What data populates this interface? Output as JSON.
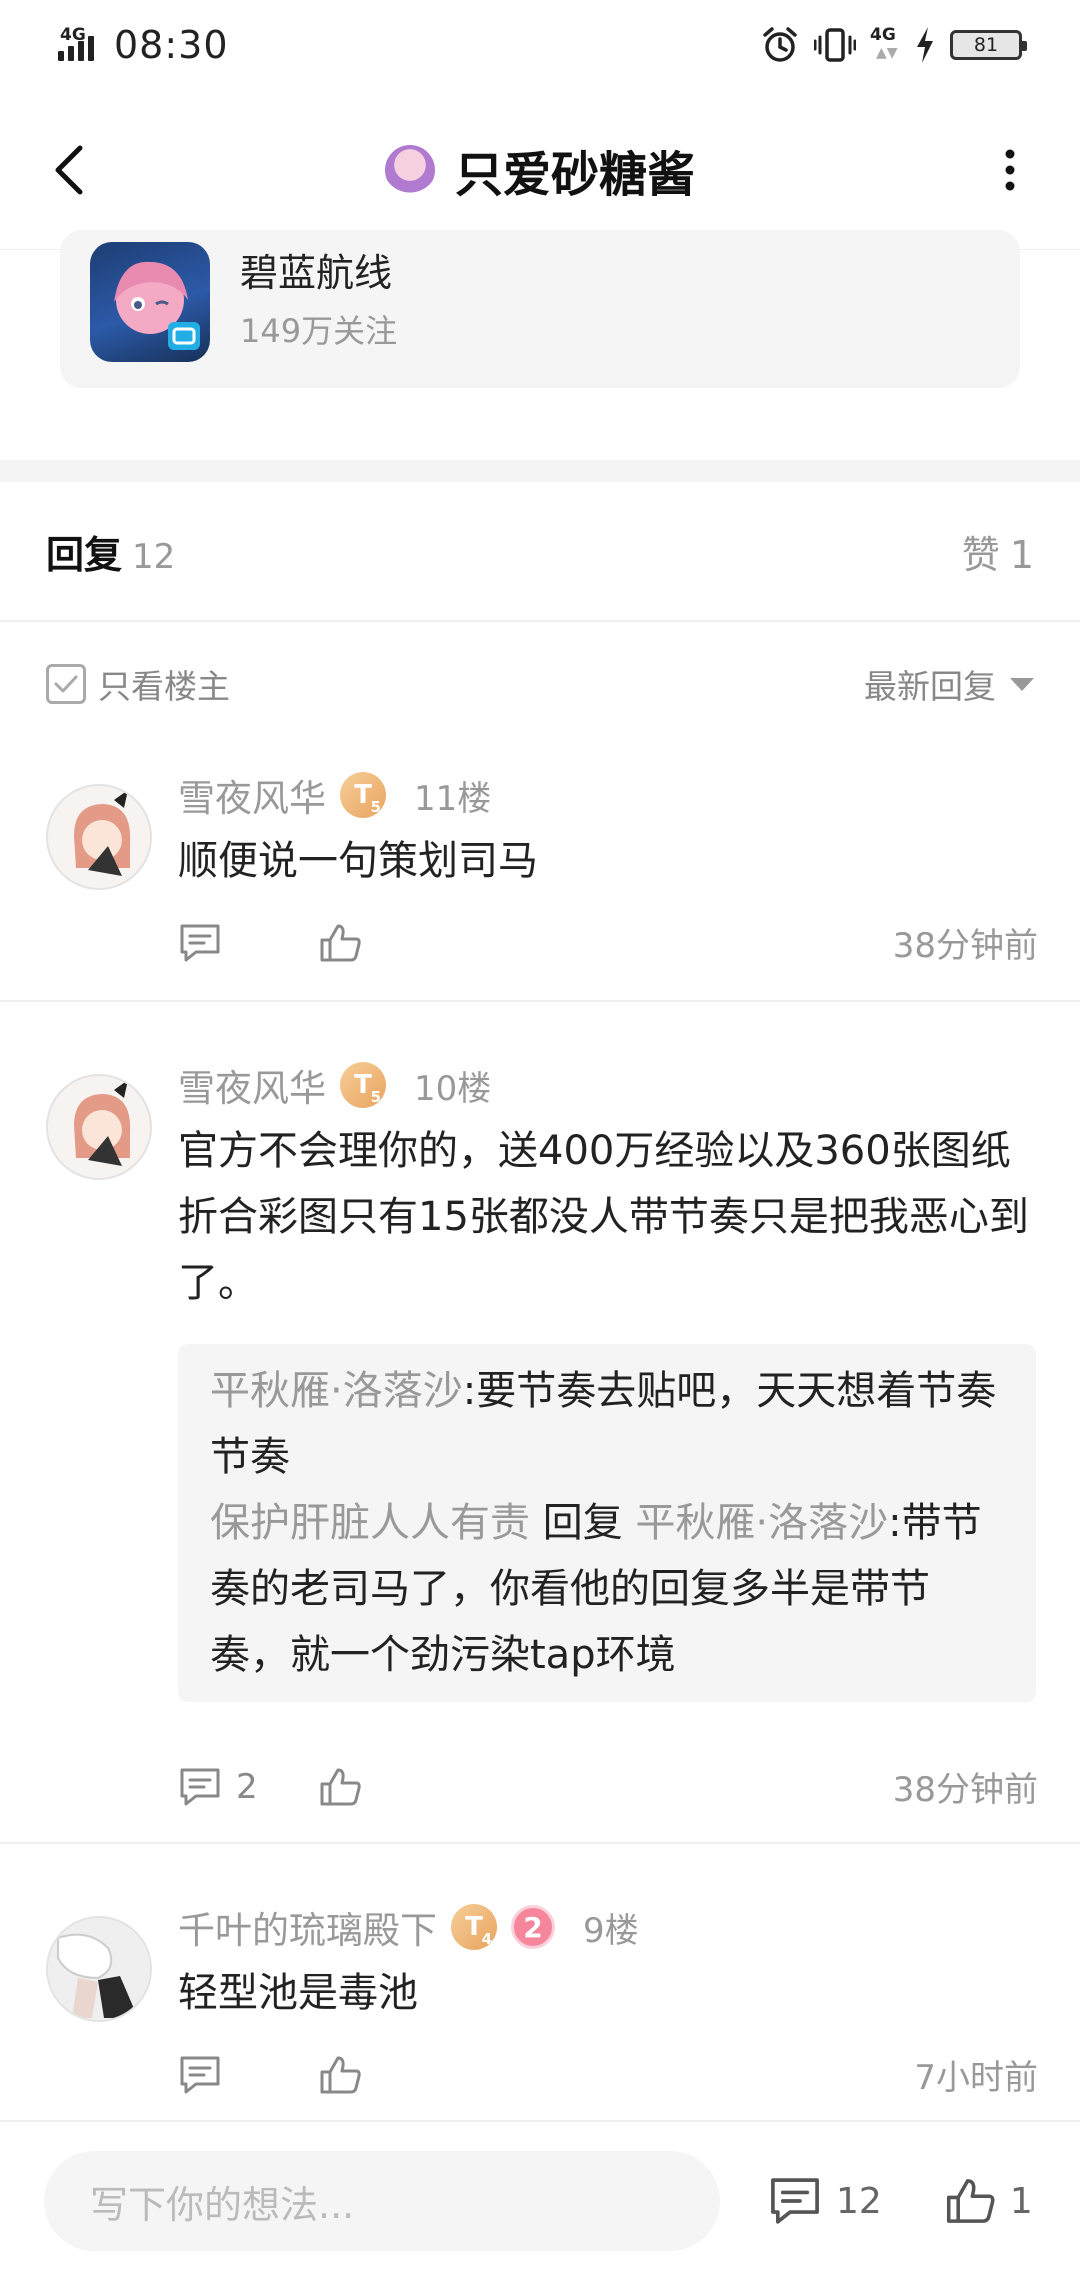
{
  "status": {
    "network": "4G",
    "time": "08:30",
    "network2": "4G",
    "battery": "81"
  },
  "nav": {
    "title": "只爱砂糖酱"
  },
  "app_card": {
    "name": "碧蓝航线",
    "followers": "149万关注"
  },
  "tabs": {
    "reply_label": "回复",
    "reply_count": "12",
    "like_label": "赞",
    "like_count": "1"
  },
  "filter": {
    "only_op": "只看楼主",
    "sort": "最新回复"
  },
  "comments": [
    {
      "name": "雪夜风华",
      "level_letter": "T",
      "level_num": "5",
      "floor": "11楼",
      "text": "顺便说一句策划司马",
      "reply_count": "",
      "time": "38分钟前"
    },
    {
      "name": "雪夜风华",
      "level_letter": "T",
      "level_num": "5",
      "floor": "10楼",
      "text": "官方不会理你的，送400万经验以及360张图纸折合彩图只有15张都没人带节奏只是把我恶心到了。",
      "replies": [
        {
          "who": "平秋雁·洛落沙",
          "sep": ":",
          "text": "要节奏去贴吧，天天想着节奏节奏"
        },
        {
          "who": "保护肝脏人人有责",
          "mid": "回复",
          "target": "平秋雁·洛落沙",
          "sep": ":",
          "text": "带节奏的老司马了，你看他的回复多半是带节奏，就一个劲污染tap环境"
        }
      ],
      "reply_count": "2",
      "time": "38分钟前"
    },
    {
      "name": "千叶的琉璃殿下",
      "level_letter": "T",
      "level_num": "4",
      "badge2": "2",
      "floor": "9楼",
      "text": "轻型池是毒池",
      "reply_count": "",
      "time": "7小时前"
    }
  ],
  "bottom": {
    "placeholder": "写下你的想法...",
    "comment_count": "12",
    "like_count": "1"
  },
  "icons": [
    "back-arrow-icon",
    "more-vertical-icon",
    "comment-icon",
    "thumbs-up-icon",
    "alarm-icon",
    "vibrate-icon",
    "charging-icon",
    "signal-icon"
  ]
}
